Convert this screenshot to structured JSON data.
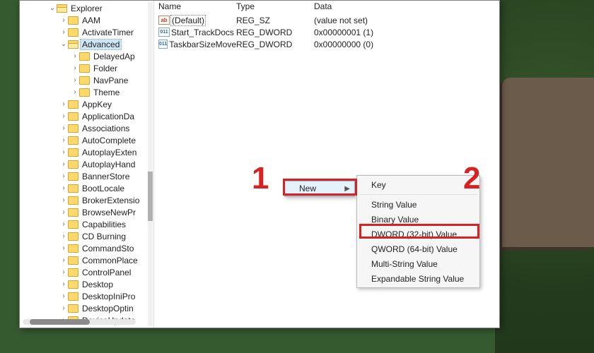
{
  "tree": {
    "root_name": "Explorer",
    "direct_children": [
      {
        "name": "AAM"
      },
      {
        "name": "ActivateTimer"
      }
    ],
    "selected": "Advanced",
    "advanced_children": [
      {
        "name": "DelayedAp"
      },
      {
        "name": "Folder"
      },
      {
        "name": "NavPane"
      },
      {
        "name": "Theme"
      }
    ],
    "siblings_after": [
      "AppKey",
      "ApplicationDa",
      "Associations",
      "AutoComplete",
      "AutoplayExten",
      "AutoplayHand",
      "BannerStore",
      "BootLocale",
      "BrokerExtensio",
      "BrowseNewPr",
      "Capabilities",
      "CD Burning",
      "CommandSto",
      "CommonPlace",
      "ControlPanel",
      "Desktop",
      "DesktopIniPro",
      "DesktopOptin",
      "DeviceUpdate"
    ]
  },
  "list": {
    "col_name": "Name",
    "col_type": "Type",
    "col_data": "Data",
    "rows": [
      {
        "icon": "sz",
        "name": "(Default)",
        "type": "REG_SZ",
        "data": "(value not set)"
      },
      {
        "icon": "dw",
        "name": "Start_TrackDocs",
        "type": "REG_DWORD",
        "data": "0x00000001 (1)"
      },
      {
        "icon": "dw",
        "name": "TaskbarSizeMove",
        "type": "REG_DWORD",
        "data": "0x00000000 (0)"
      }
    ]
  },
  "menu": {
    "new_label": "New",
    "items": [
      "Key",
      "String Value",
      "Binary Value",
      "DWORD (32-bit) Value",
      "QWORD (64-bit) Value",
      "Multi-String Value",
      "Expandable String Value"
    ]
  },
  "callouts": {
    "one": "1",
    "two": "2"
  }
}
